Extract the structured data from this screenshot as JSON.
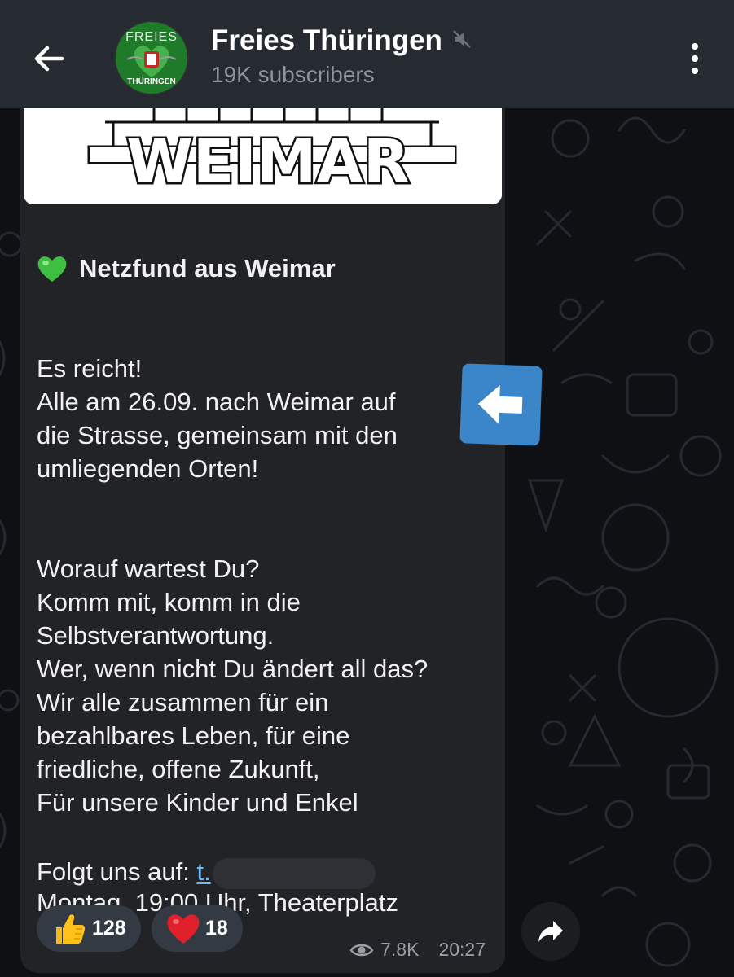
{
  "header": {
    "title": "Freies Thüringen",
    "subscribers": "19K subscribers",
    "avatar_text_top": "FREIES",
    "avatar_text_bottom": "THÜRINGEN"
  },
  "media": {
    "caption_text": "WEIMAR"
  },
  "message": {
    "heading": "Netzfund aus Weimar",
    "paragraphs": [
      "Es reicht!\nAlle am 26.09. nach Weimar auf\ndie Strasse, gemeinsam mit den\numliegenden Orten!",
      "Worauf wartest Du?\nKomm mit, komm in die\nSelbstverantwortung.\nWer, wenn nicht Du ändert all das?\nWir alle zusammen für ein\nbezahlbares Leben, für eine\nfriedliche, offene Zukunft,\nFür unsere Kinder und Enkel",
      "Montag, 19:00 Uhr, Theaterplatz"
    ],
    "follow_label": "Folgt uns auf: ",
    "follow_link": "t."
  },
  "reactions": [
    {
      "emoji": "thumbs-up",
      "count": "128"
    },
    {
      "emoji": "red-heart",
      "count": "18"
    }
  ],
  "meta": {
    "views": "7.8K",
    "time": "20:27"
  },
  "colors": {
    "header_bg": "#262a31",
    "bubble_bg": "#212327",
    "link": "#73b9f5",
    "annotation_arrow": "#3b86c9"
  }
}
